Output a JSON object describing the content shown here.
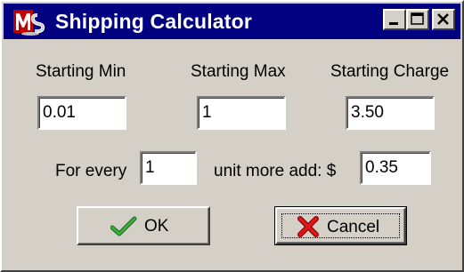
{
  "window": {
    "title": "Shipping Calculator",
    "icon": "ms-logo-icon"
  },
  "labels": {
    "starting_min": "Starting Min",
    "starting_max": "Starting Max",
    "starting_charge": "Starting Charge",
    "for_every": "For every",
    "unit_more_add": "unit more add: $"
  },
  "fields": {
    "starting_min": "0.01",
    "starting_max": "1",
    "starting_charge": "3.50",
    "every_units": "1",
    "add_amount": "0.35"
  },
  "buttons": {
    "ok": {
      "label": "OK",
      "icon": "checkmark-icon"
    },
    "cancel": {
      "label": "Cancel",
      "icon": "red-x-icon"
    }
  },
  "colors": {
    "titlebar": "#000080",
    "face": "#d4d0c8",
    "ok_check": "#2e8b2e",
    "cancel_x": "#cc0000"
  }
}
